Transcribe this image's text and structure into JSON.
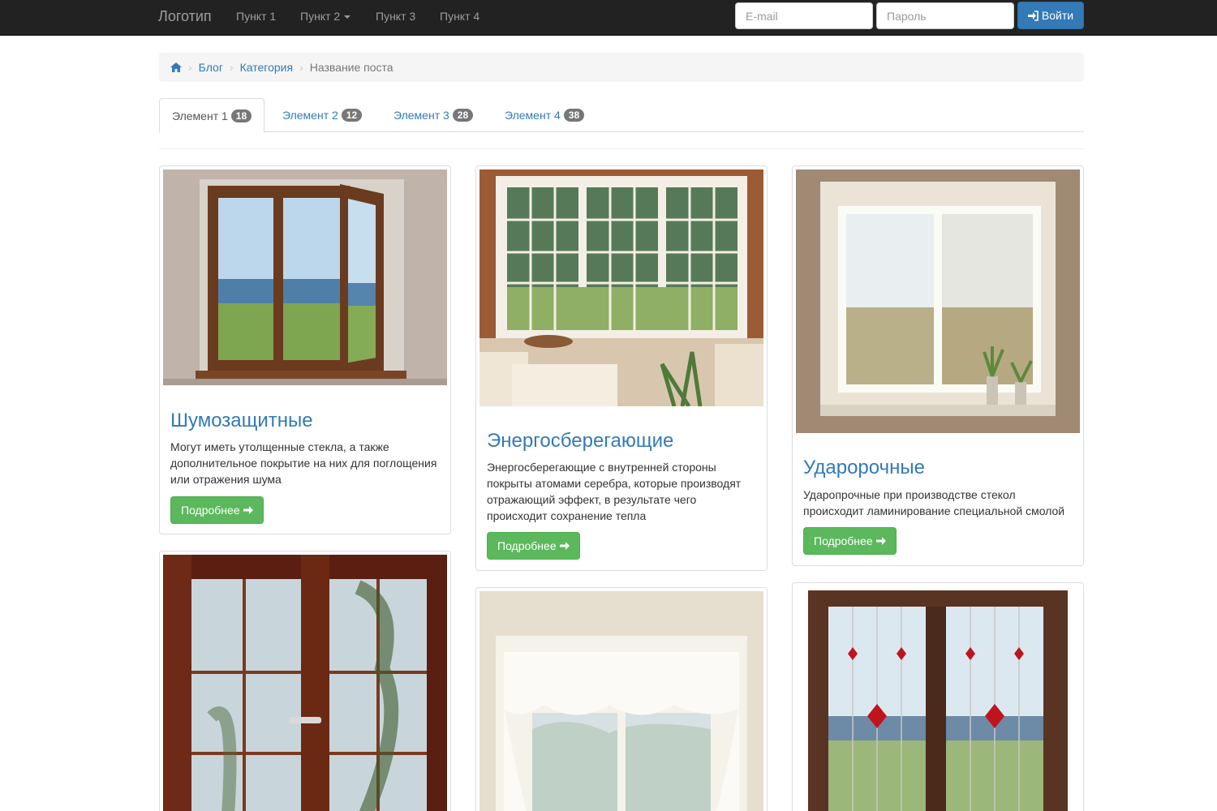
{
  "navbar": {
    "brand": "Логотип",
    "items": [
      {
        "label": "Пункт 1"
      },
      {
        "label": "Пункт 2"
      },
      {
        "label": "Пункт 3"
      },
      {
        "label": "Пункт 4"
      }
    ],
    "email_placeholder": "E-mail",
    "password_placeholder": "Пароль",
    "login_label": "Войти",
    "login_icon": "sign-in-icon"
  },
  "breadcrumb": {
    "home_icon": "home-icon",
    "items": [
      "Блог",
      "Категория"
    ],
    "current": "Название поста"
  },
  "tabs": [
    {
      "label": "Элемент 1",
      "count": "18"
    },
    {
      "label": "Элемент 2",
      "count": "12"
    },
    {
      "label": "Элемент 3",
      "count": "28"
    },
    {
      "label": "Элемент 4",
      "count": "38"
    }
  ],
  "cards": [
    {
      "title": "Шумозащитные",
      "text": "Могут иметь утолщенные стекла, а также дополнительное покрытие на них для поглощения или отражения шума",
      "button": "Подробнее"
    },
    {
      "title": "Энергосберегающие",
      "text": "Энергосберегающие с внутренней стороны покрыты атомами серебра, которые производят отражающий эффект, в результате чего происходит сохранение тепла",
      "button": "Подробнее"
    },
    {
      "title": "Удароpочные",
      "text": "Ударопрочные при производстве стекол происходит ламинирование специальной смолой",
      "button": "Подробнее"
    }
  ],
  "colors": {
    "navbar": "#222222",
    "link": "#337ab7",
    "success": "#5cb85c",
    "badge": "#777777"
  }
}
